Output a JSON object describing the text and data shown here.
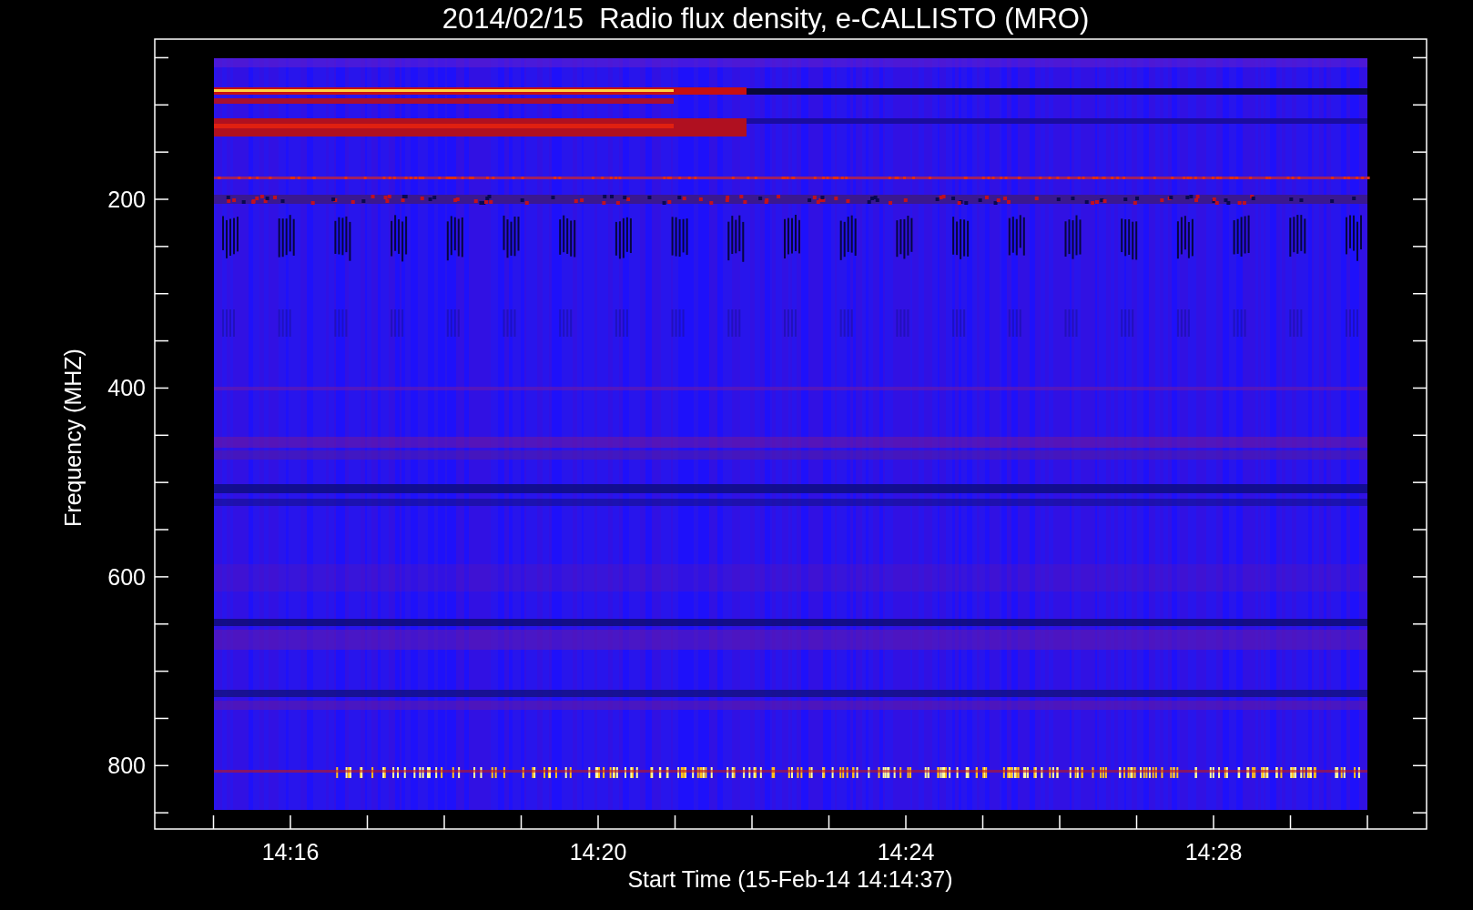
{
  "title": "2014/02/15  Radio flux density, e-CALLISTO (MRO)",
  "y_axis": {
    "label": "Frequency (MHZ)",
    "ticks": [
      "200",
      "400",
      "600",
      "800"
    ]
  },
  "x_axis": {
    "label": "Start Time (15-Feb-14 14:14:37)",
    "ticks": [
      "14:16",
      "14:20",
      "14:24",
      "14:28"
    ]
  }
}
